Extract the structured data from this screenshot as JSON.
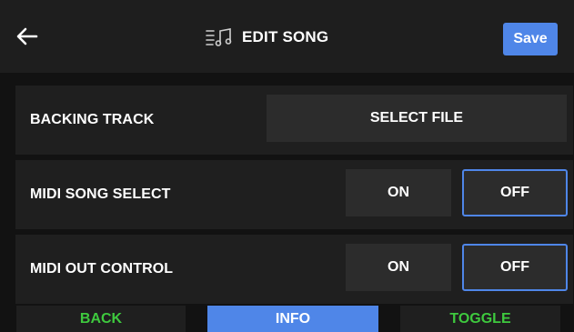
{
  "header": {
    "title": "EDIT SONG",
    "save_label": "Save",
    "back_icon": "arrow-left-icon",
    "title_icon": "music-list-icon"
  },
  "rows": [
    {
      "label": "BACKING TRACK",
      "action_label": "SELECT FILE"
    },
    {
      "label": "MIDI SONG SELECT",
      "on_label": "ON",
      "off_label": "OFF",
      "selected": "OFF"
    },
    {
      "label": "MIDI OUT CONTROL",
      "on_label": "ON",
      "off_label": "OFF",
      "selected": "OFF"
    }
  ],
  "bottom_bar": {
    "back_label": "BACK",
    "info_label": "INFO",
    "toggle_label": "TOGGLE"
  },
  "colors": {
    "accent": "#4f86e8",
    "green": "#3ec93e",
    "background": "#121212",
    "panel": "#1f1f1f",
    "button": "#2c2c2c"
  }
}
